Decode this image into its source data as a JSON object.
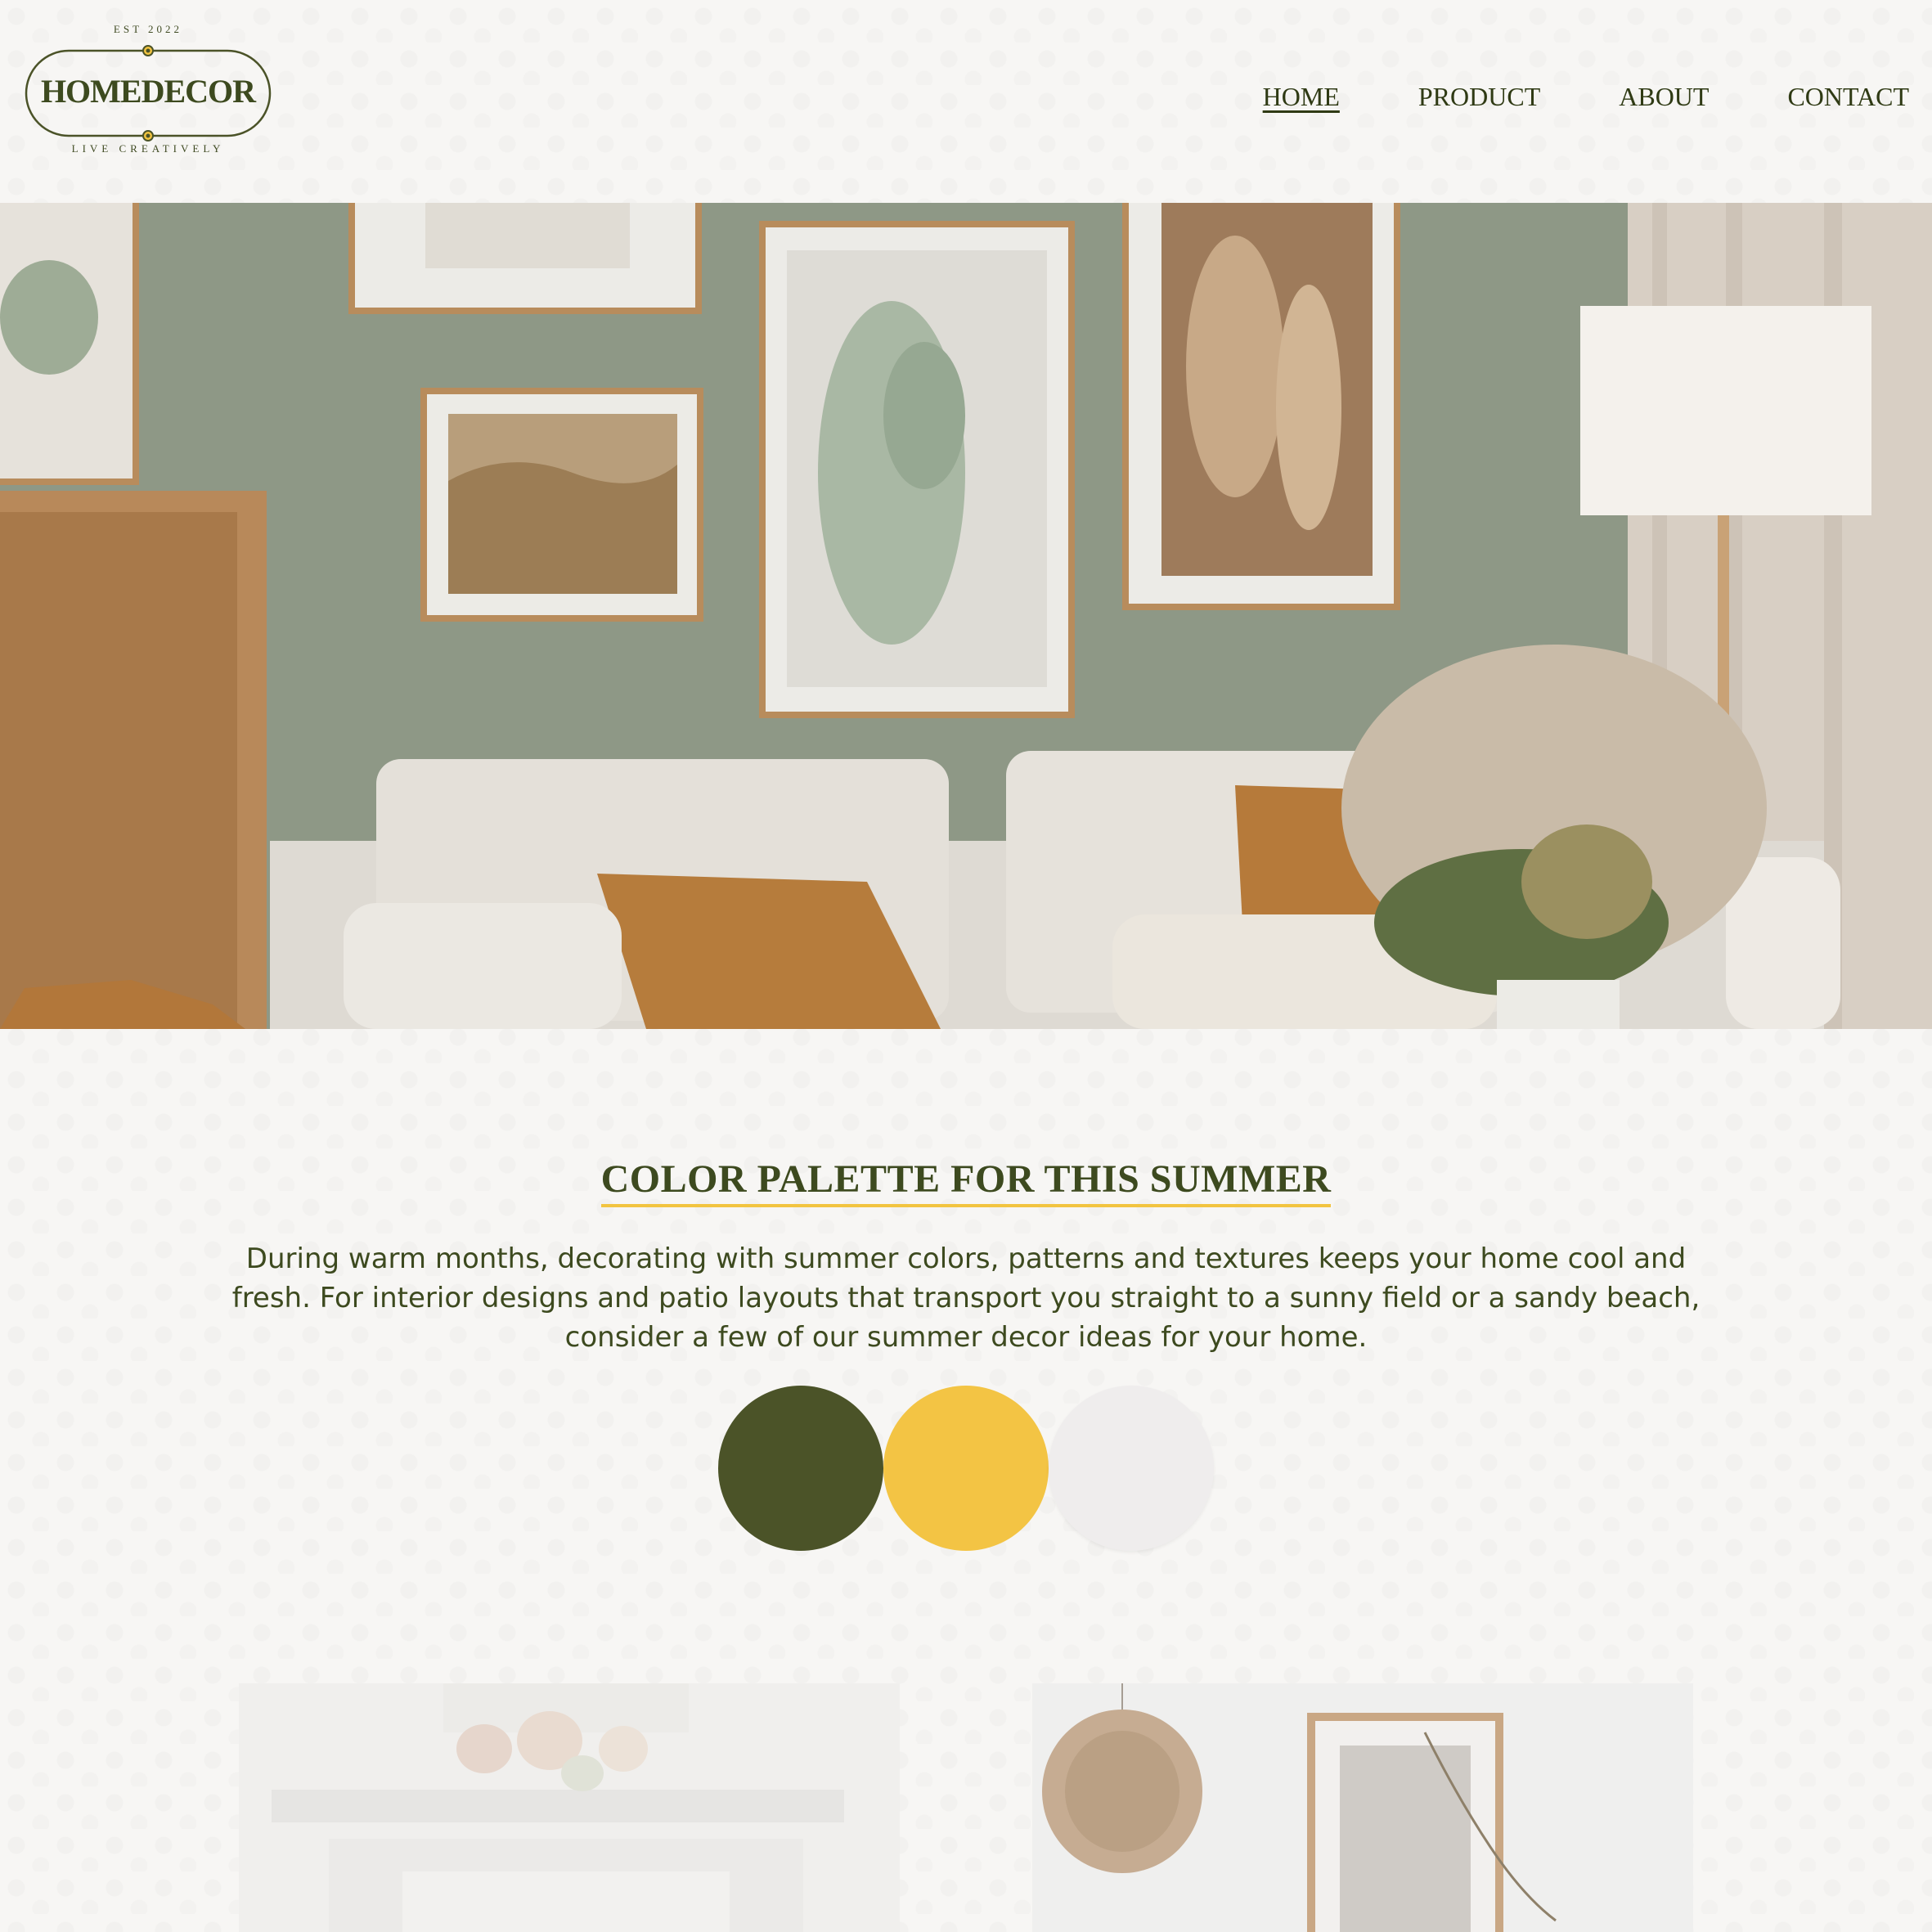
{
  "brand": {
    "est": "EST 2022",
    "name": "HOMEDECOR",
    "tagline": "LIVE CREATIVELY"
  },
  "nav": {
    "items": [
      {
        "label": "HOME",
        "active": true
      },
      {
        "label": "PRODUCT",
        "active": false
      },
      {
        "label": "ABOUT",
        "active": false
      },
      {
        "label": "CONTACT",
        "active": false
      }
    ]
  },
  "hero": {
    "image": "living-room-gallery-wall"
  },
  "palette_section": {
    "title": "COLOR PALETTE FOR THIS SUMMER",
    "description": "During warm months, decorating with summer colors, patterns and textures keeps your home cool and fresh. For interior designs and patio layouts that transport you straight to a sunny field or a sandy beach, consider a few of our summer decor ideas for your home.",
    "colors": [
      "#4b5328",
      "#f3c444",
      "#efeded"
    ]
  },
  "gallery": {
    "left_image": "fireplace-mantel-pumpkins",
    "right_image": "rattan-pendant-wall-art"
  }
}
